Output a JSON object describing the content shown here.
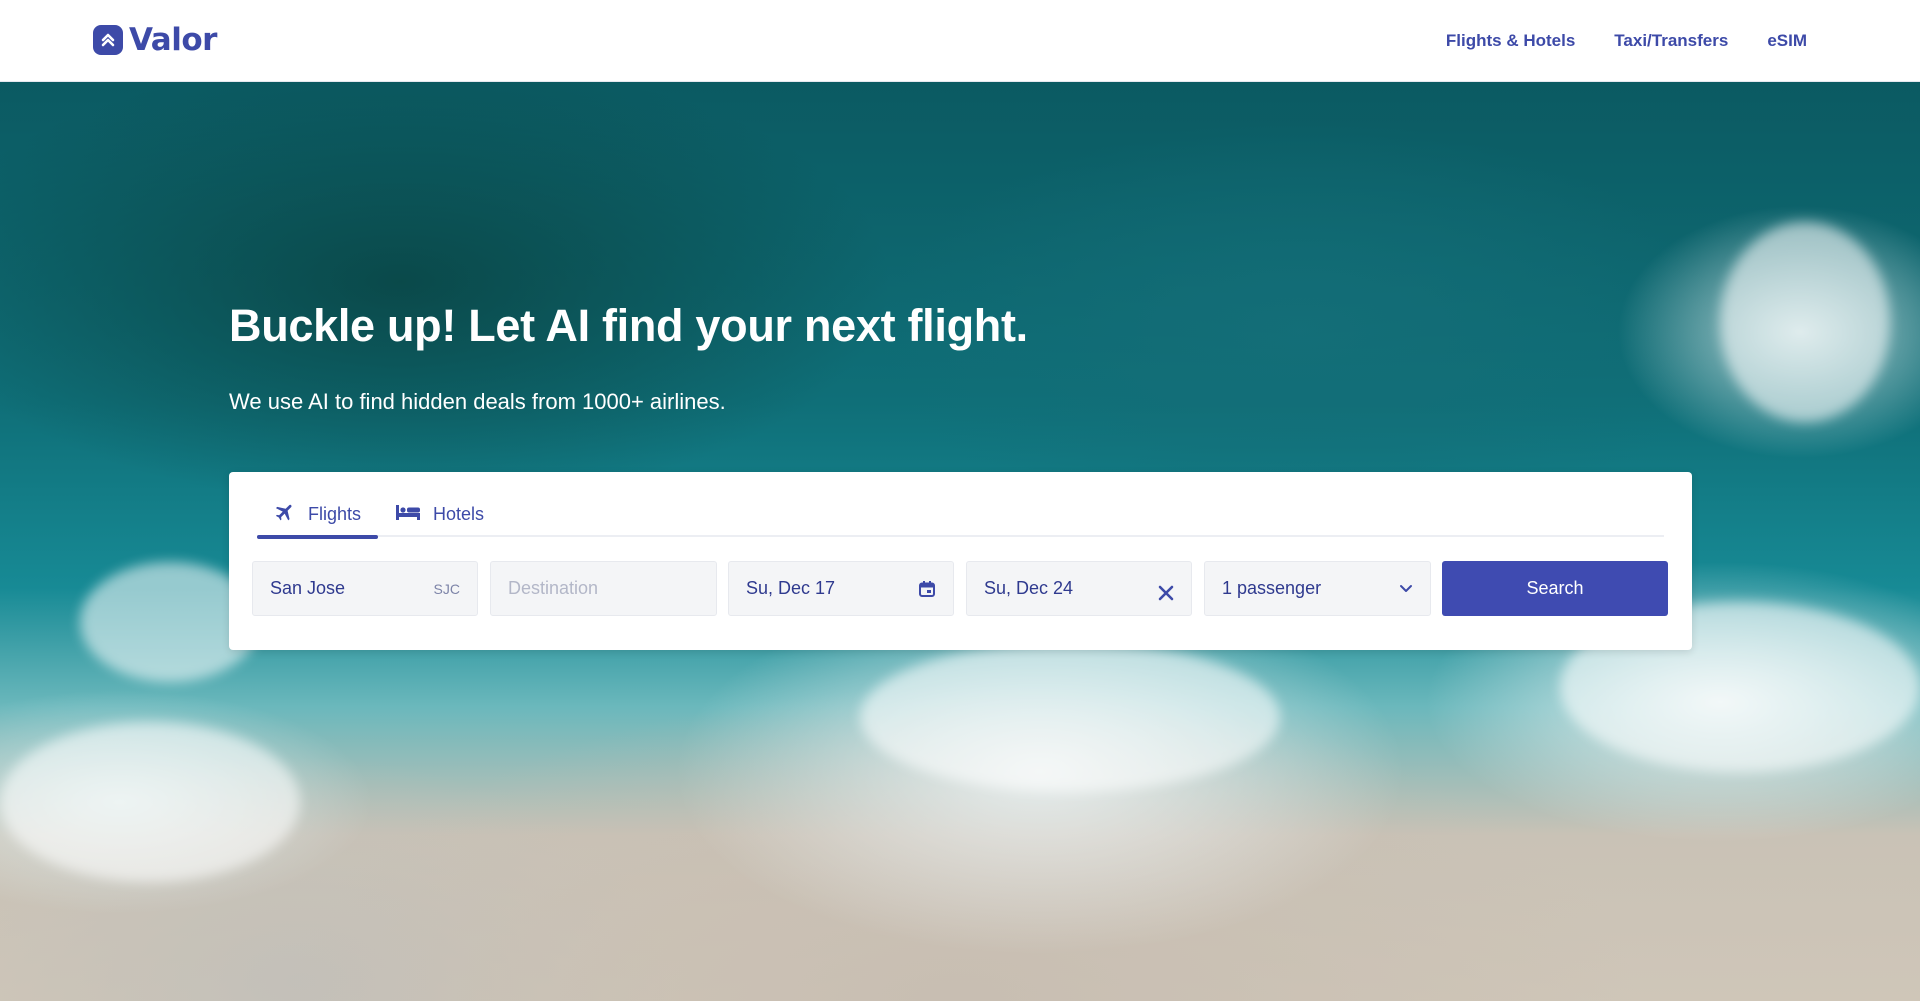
{
  "brand": {
    "name": "Valor",
    "color": "#3d4aa8"
  },
  "nav": {
    "items": [
      "Flights & Hotels",
      "Taxi/Transfers",
      "eSIM"
    ]
  },
  "hero": {
    "headline": "Buckle up! Let AI find your next flight.",
    "subhead": "We use AI to find hidden deals from 1000+ airlines."
  },
  "search": {
    "tabs": [
      {
        "label": "Flights",
        "icon": "airplane-icon",
        "active": true
      },
      {
        "label": "Hotels",
        "icon": "bed-icon",
        "active": false
      }
    ],
    "origin": {
      "value": "San Jose",
      "code": "SJC"
    },
    "destination": {
      "placeholder": "Destination",
      "value": ""
    },
    "depart_date": {
      "value": "Su, Dec 17",
      "icon": "calendar-icon"
    },
    "return_date": {
      "value": "Su, Dec 24",
      "icon": "close-icon"
    },
    "passengers": {
      "value": "1 passenger",
      "icon": "chevron-down-icon"
    },
    "button_label": "Search"
  }
}
